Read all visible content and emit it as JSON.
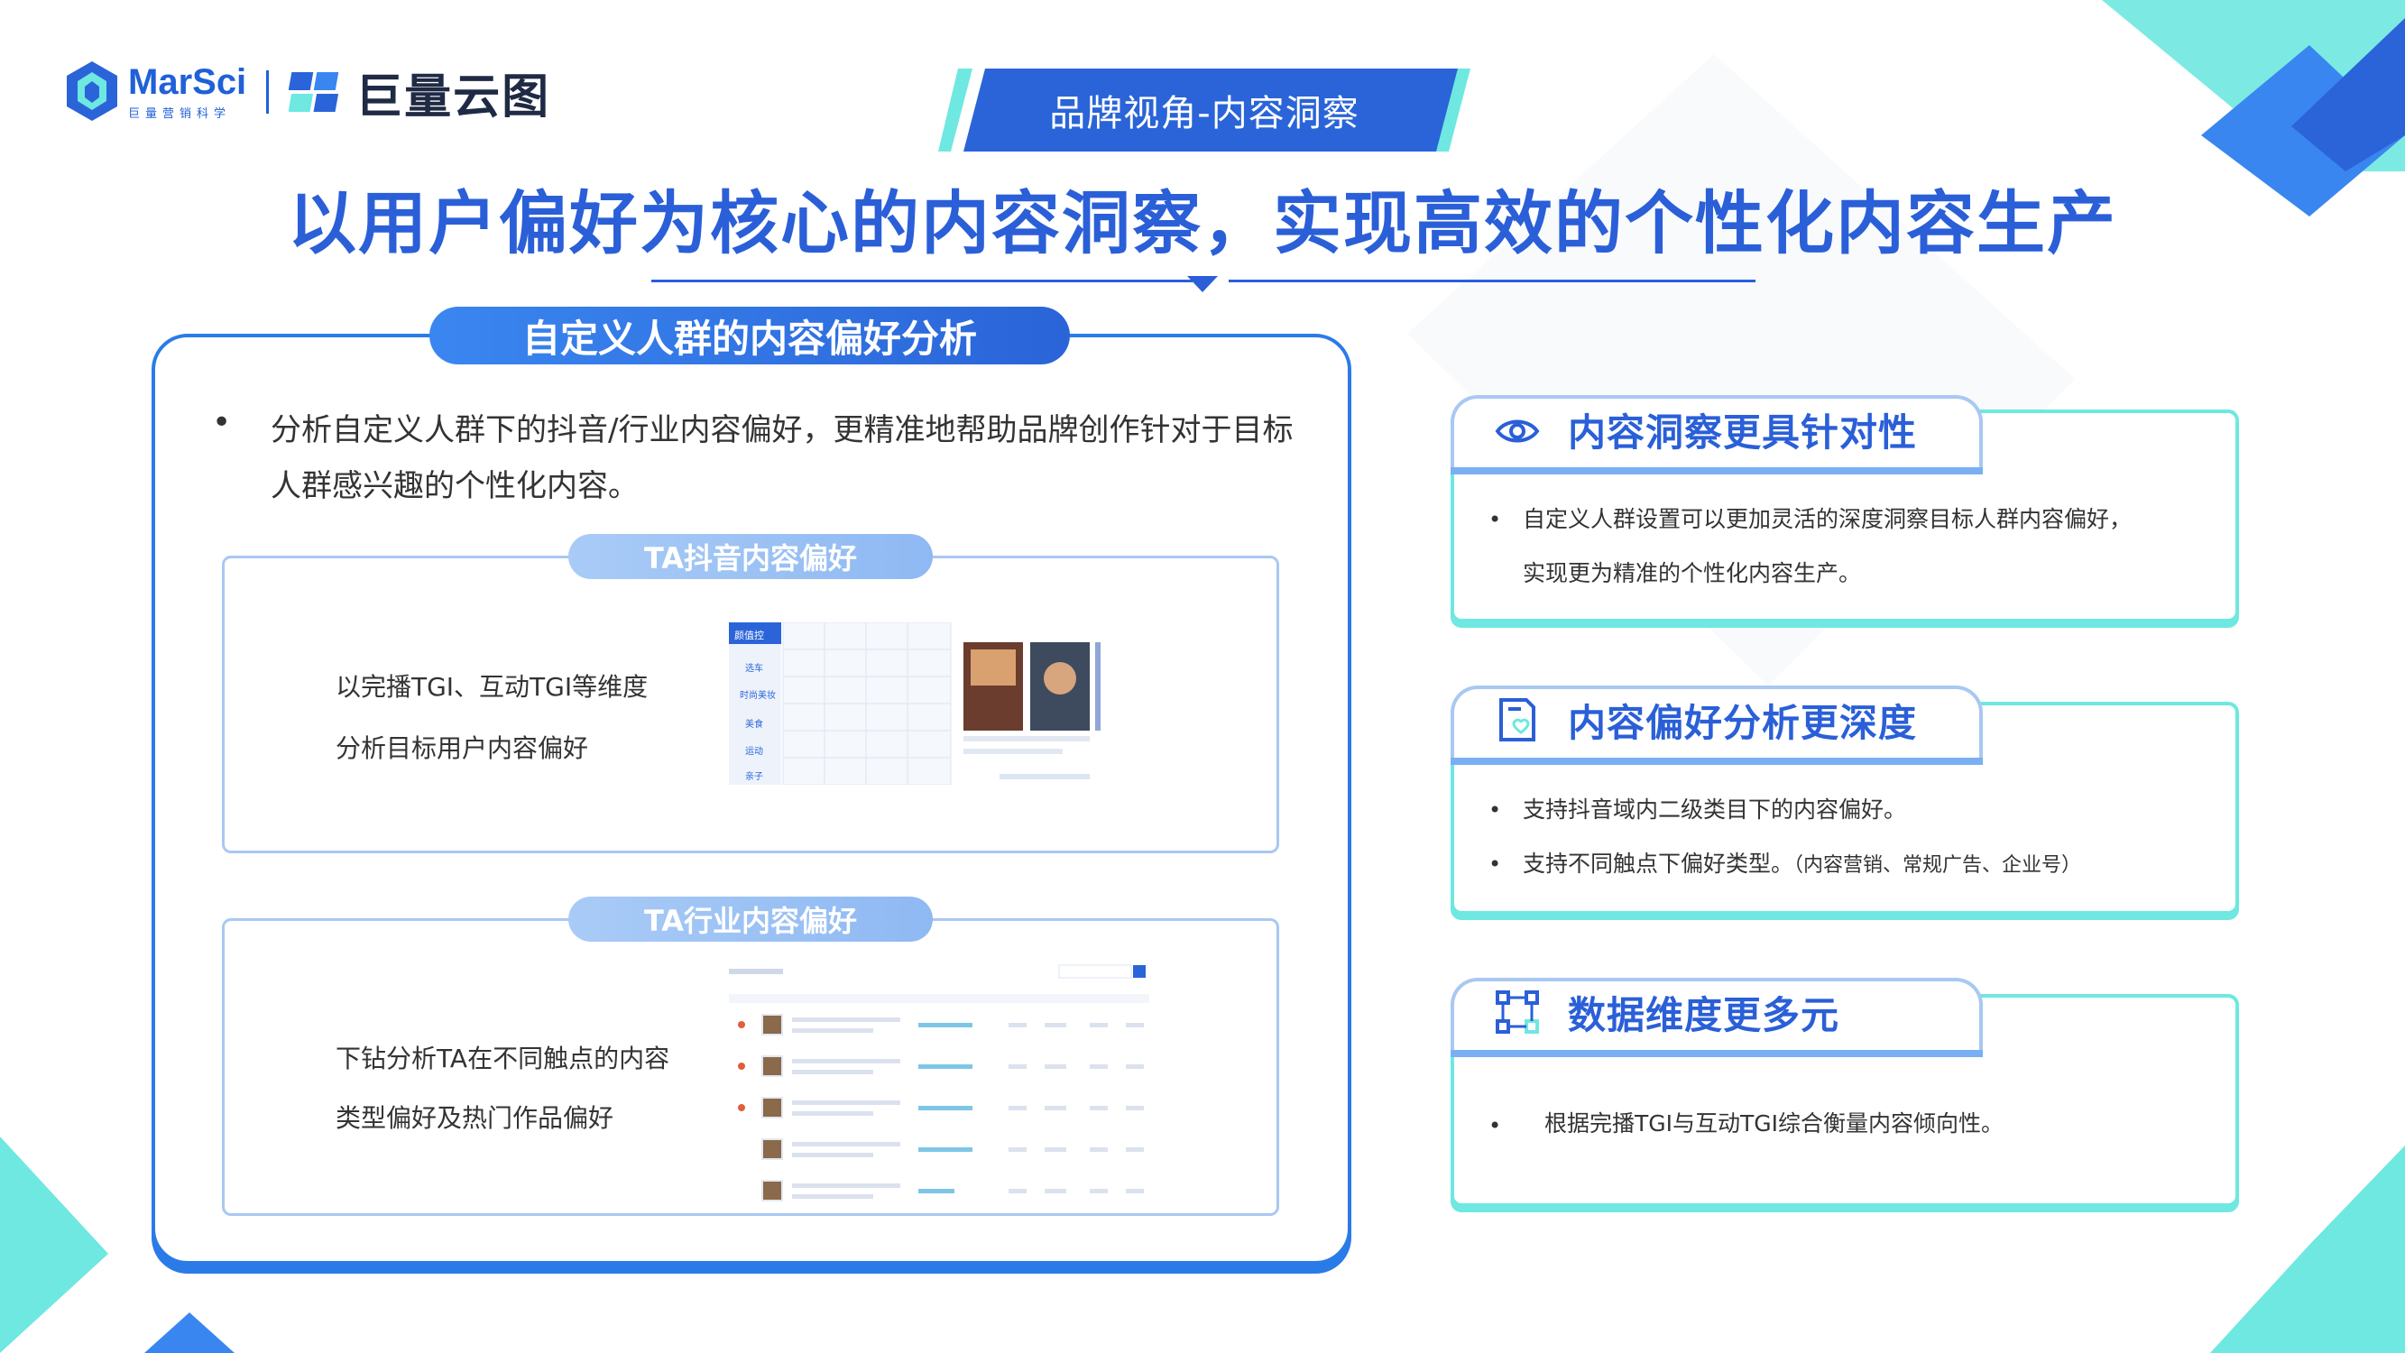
{
  "header": {
    "logo_marsci": "MarSci",
    "logo_marsci_sub": "巨量营销科学",
    "logo_yuntu": "巨量云图",
    "tag": "品牌视角-内容洞察",
    "main_title": "以用户偏好为核心的内容洞察，实现高效的个性化内容生产"
  },
  "left": {
    "pill": "自定义人群的内容偏好分析",
    "bullet": "•",
    "desc": "分析自定义人群下的抖音/行业内容偏好，更精准地帮助品牌创作针对于目标人群感兴趣的个性化内容。",
    "card1": {
      "pill": "TA抖音内容偏好",
      "line1": "以完播TGI、互动TGI等维度",
      "line2": "分析目标用户内容偏好",
      "mini_tabs": [
        "颜值控",
        "选车",
        "时尚美妆",
        "美食",
        "运动",
        "亲子"
      ]
    },
    "card2": {
      "pill": "TA行业内容偏好",
      "line1": "下钻分析TA在不同触点的内容",
      "line2": "类型偏好及热门作品偏好"
    }
  },
  "right": [
    {
      "title": "内容洞察更具针对性",
      "icon": "eye-icon",
      "bullets": [
        "自定义人群设置可以更加灵活的深度洞察目标人群内容偏好，",
        "实现更为精准的个性化内容生产。"
      ]
    },
    {
      "title": "内容偏好分析更深度",
      "icon": "document-heart-icon",
      "bullets": [
        "支持抖音域内二级类目下的内容偏好。",
        "支持不同触点下偏好类型。"
      ],
      "note": "（内容营销、常规广告、企业号）"
    },
    {
      "title": "数据维度更多元",
      "icon": "network-nodes-icon",
      "bullets": [
        "根据完播TGI与互动TGI综合衡量内容倾向性。"
      ]
    }
  ],
  "colors": {
    "primary": "#2a5fd8",
    "accent": "#6ee8e0",
    "light_blue": "#a9c8f3"
  }
}
